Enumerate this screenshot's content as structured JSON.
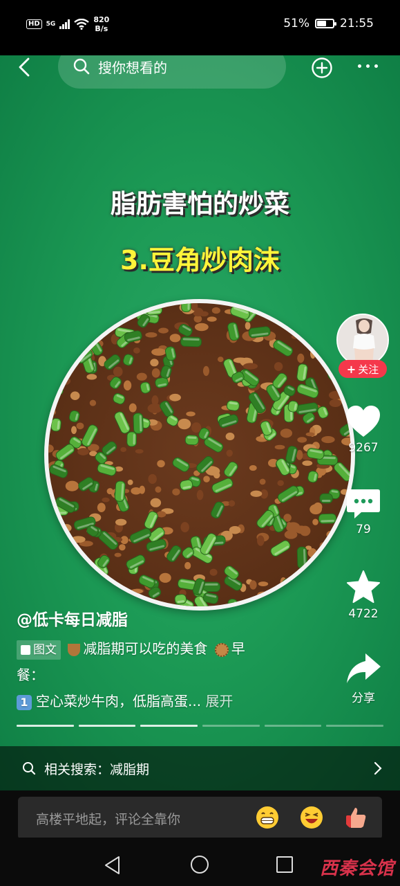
{
  "status_bar": {
    "hd": "HD",
    "network": "5G",
    "speed_value": "820",
    "speed_unit": "B/s",
    "battery": "51%",
    "battery_level": 0.51,
    "time": "21:55"
  },
  "top_bar": {
    "search_placeholder": "搜你想看的"
  },
  "post": {
    "title": "脂肪害怕的炒菜",
    "subtitle": "3.豆角炒肉沫",
    "author": "@低卡每日减脂",
    "tag": "图文",
    "desc_line1": "减脂期可以吃的美食",
    "desc_line1_tail": "早",
    "desc_line2": "餐：",
    "desc_line3_badge": "1",
    "desc_line3": "空心菜炒牛肉，低脂高蛋...",
    "expand": "展开",
    "progress_total": 6,
    "progress_active": 3
  },
  "actions": {
    "follow": "关注",
    "likes": "9267",
    "comments": "79",
    "favorites": "4722",
    "share": "分享"
  },
  "related_search": {
    "label": "相关搜索：减脂期"
  },
  "comment_bar": {
    "placeholder": "高楼平地起，评论全靠你"
  },
  "icons": [
    "back-icon",
    "search-icon",
    "plus-circle-icon",
    "more-icon",
    "heart-icon",
    "comment-icon",
    "star-icon",
    "share-icon",
    "chevron-right-icon",
    "grin-emoji-icon",
    "laugh-emoji-icon",
    "thumbs-up-emoji-icon"
  ],
  "colors": {
    "follow_bg": "#f5384b",
    "subtitle": "#fff43a",
    "watermark": "#d8324b"
  },
  "watermark": "西秦会馆"
}
